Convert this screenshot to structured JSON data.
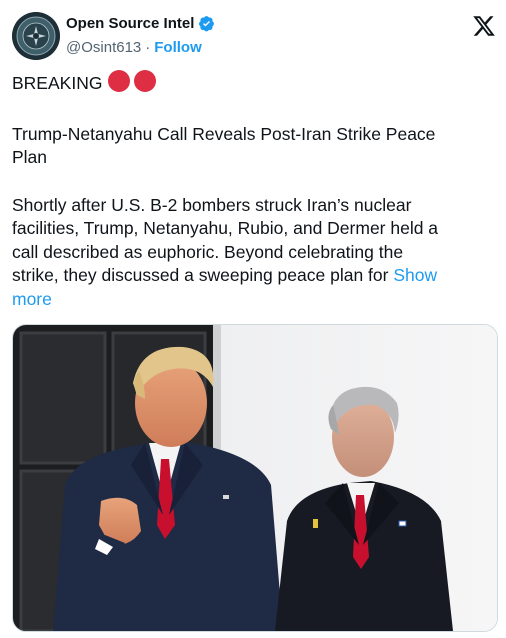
{
  "account": {
    "display_name": "Open Source Intel",
    "handle": "@Osint613",
    "separator": "·",
    "follow_label": "Follow",
    "verified_color": "#1d9bf0"
  },
  "post": {
    "breaking_label": "BREAKING",
    "headline_line1": "Trump-Netanyahu Call Reveals Post-Iran Strike Peace",
    "headline_line2": "Plan",
    "body_line1": "Shortly after U.S. B-2 bombers struck Iran’s nuclear",
    "body_line2": "facilities, Trump, Netanyahu, Rubio, and Dermer held a",
    "body_line3": "call described as euphoric. Beyond celebrating the",
    "body_line4": "strike, they discussed a sweeping peace plan for",
    "show_more_part1": "Show",
    "show_more_part2": "more",
    "emoji": [
      "red-circle",
      "red-circle"
    ]
  },
  "colors": {
    "link": "#1d9bf0",
    "text": "#0f1419",
    "muted": "#536471",
    "emoji_red": "#dd2e44"
  },
  "icons": {
    "platform": "x-logo-icon",
    "verified": "verified-badge-icon"
  }
}
